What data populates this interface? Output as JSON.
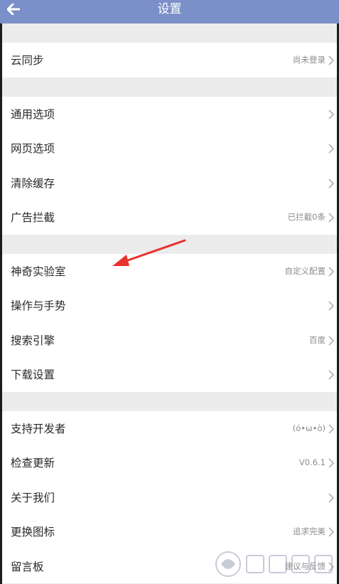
{
  "header": {
    "title": "设置",
    "back_icon": "arrow-left-icon",
    "background_color": "#7b8fc8"
  },
  "groups": [
    {
      "items": [
        {
          "label": "云同步",
          "value": "尚未登录",
          "icon": "chevron-right-icon"
        }
      ]
    },
    {
      "items": [
        {
          "label": "通用选项",
          "value": "",
          "icon": "chevron-right-icon"
        },
        {
          "label": "网页选项",
          "value": "",
          "icon": "chevron-right-icon"
        },
        {
          "label": "清除缓存",
          "value": "",
          "icon": "chevron-right-icon"
        },
        {
          "label": "广告拦截",
          "value": "已拦截0条",
          "icon": "chevron-right-icon"
        }
      ]
    },
    {
      "items": [
        {
          "label": "神奇实验室",
          "value": "自定义配置",
          "icon": "chevron-right-icon"
        },
        {
          "label": "操作与手势",
          "value": "",
          "icon": "chevron-right-icon"
        },
        {
          "label": "搜索引擎",
          "value": "百度",
          "icon": "chevron-right-icon"
        },
        {
          "label": "下载设置",
          "value": "",
          "icon": "chevron-right-icon"
        }
      ]
    },
    {
      "items": [
        {
          "label": "支持开发者",
          "value": "(ó•ω•ò)",
          "icon": "chevron-right-icon"
        },
        {
          "label": "检查更新",
          "value": "V0.6.1",
          "icon": "chevron-right-icon"
        },
        {
          "label": "关于我们",
          "value": "",
          "icon": "chevron-right-icon"
        },
        {
          "label": "更换图标",
          "value": "追求完美",
          "icon": "chevron-right-icon"
        },
        {
          "label": "留言板",
          "value": "建议与反馈",
          "icon": "chevron-right-icon"
        }
      ]
    }
  ],
  "annotation": {
    "icon": "red-arrow-icon",
    "color": "#e8322e"
  }
}
